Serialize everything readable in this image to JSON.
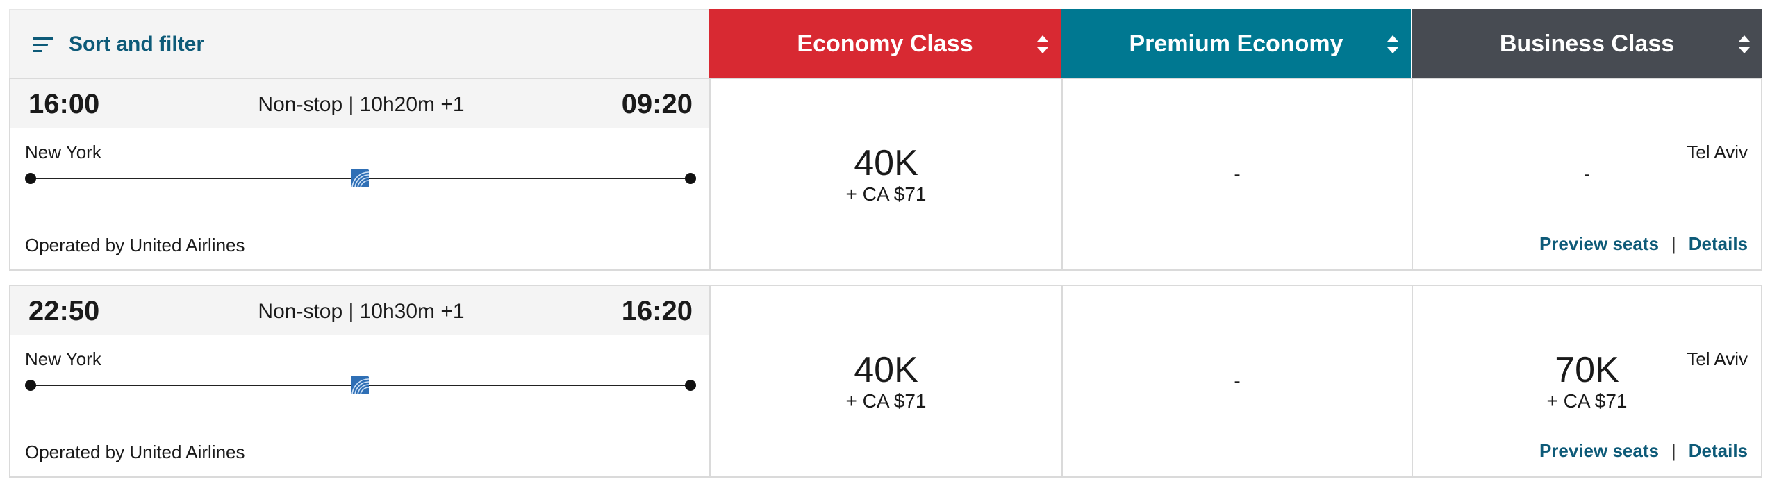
{
  "filter": {
    "label": "Sort and filter",
    "icon": "sort-filter-icon"
  },
  "cabins": [
    {
      "label": "Economy Class",
      "color": "#d82932"
    },
    {
      "label": "Premium Economy",
      "color": "#007891"
    },
    {
      "label": "Business Class",
      "color": "#474b52"
    }
  ],
  "flights": [
    {
      "departure": "16:00",
      "arrival": "09:20",
      "summary": "Non-stop | 10h20m +1",
      "origin": "New York",
      "destination": "Tel Aviv",
      "operated_by": "Operated by United Airlines",
      "preview_label": "Preview seats",
      "separator": "|",
      "details_label": "Details",
      "fares": [
        {
          "points": "40K",
          "tax": "+ CA $71"
        },
        {
          "dash": "-"
        },
        {
          "dash": "-"
        }
      ]
    },
    {
      "departure": "22:50",
      "arrival": "16:20",
      "summary": "Non-stop | 10h30m +1",
      "origin": "New York",
      "destination": "Tel Aviv",
      "operated_by": "Operated by United Airlines",
      "preview_label": "Preview seats",
      "separator": "|",
      "details_label": "Details",
      "fares": [
        {
          "points": "40K",
          "tax": "+ CA $71"
        },
        {
          "dash": "-"
        },
        {
          "points": "70K",
          "tax": "+ CA $71"
        }
      ]
    }
  ]
}
